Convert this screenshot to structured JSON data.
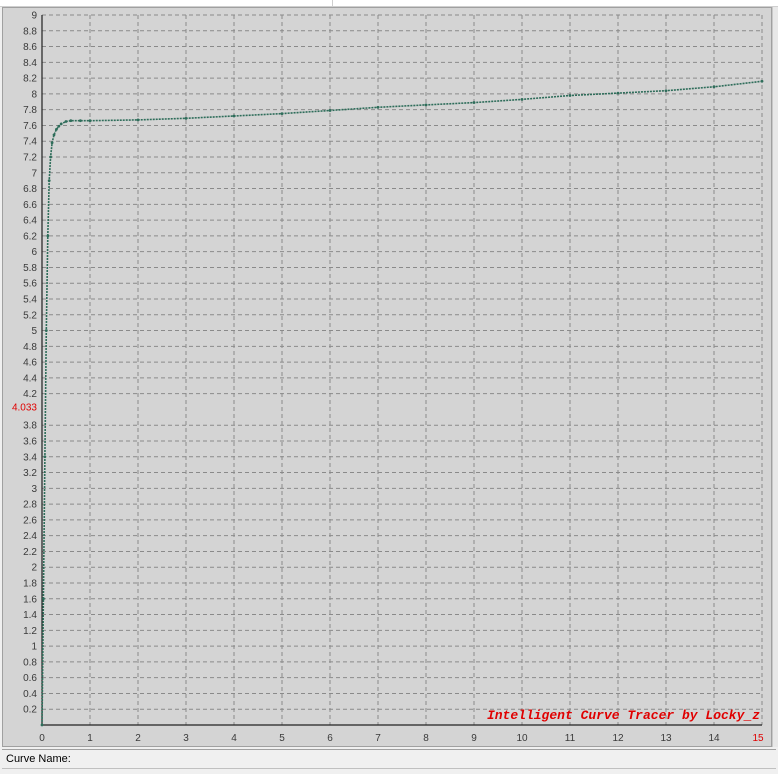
{
  "status_bar": {
    "curve_name_label": "Curve Name:"
  },
  "chart_data": {
    "type": "line",
    "title": "",
    "xlabel": "",
    "ylabel": "",
    "xlim": [
      0,
      15
    ],
    "ylim": [
      0,
      9
    ],
    "x_ticks": [
      0,
      1,
      2,
      3,
      4,
      5,
      6,
      7,
      8,
      9,
      10,
      11,
      12,
      13,
      14,
      15
    ],
    "y_ticks": [
      0.2,
      0.4,
      0.6,
      0.8,
      1,
      1.2,
      1.4,
      1.6,
      1.8,
      2,
      2.2,
      2.4,
      2.6,
      2.8,
      3,
      3.2,
      3.4,
      3.6,
      3.8,
      4.033,
      4.2,
      4.4,
      4.6,
      4.8,
      5,
      5.2,
      5.4,
      5.6,
      5.8,
      6,
      6.2,
      6.4,
      6.6,
      6.8,
      7,
      7.2,
      7.4,
      7.6,
      7.8,
      8,
      8.2,
      8.4,
      8.6,
      8.8,
      9
    ],
    "highlighted_y_tick": "4.033",
    "highlighted_x_tick": "15",
    "grid": true,
    "watermark": "Intelligent Curve Tracer by Locky_z",
    "series": [
      {
        "x": [
          0,
          0.03,
          0.06,
          0.09,
          0.12,
          0.15,
          0.18,
          0.21,
          0.25,
          0.3,
          0.35,
          0.4,
          0.5,
          0.6,
          0.8,
          1,
          2,
          3,
          4,
          5,
          6,
          7,
          8,
          9,
          10,
          11,
          12,
          13,
          14,
          15
        ],
        "y": [
          0,
          1.6,
          3.4,
          5.0,
          6.2,
          6.9,
          7.2,
          7.38,
          7.48,
          7.55,
          7.59,
          7.62,
          7.65,
          7.66,
          7.66,
          7.66,
          7.67,
          7.69,
          7.72,
          7.75,
          7.79,
          7.83,
          7.86,
          7.89,
          7.93,
          7.98,
          8.01,
          8.04,
          8.09,
          8.16
        ],
        "color": "#2e6d5a"
      }
    ]
  }
}
